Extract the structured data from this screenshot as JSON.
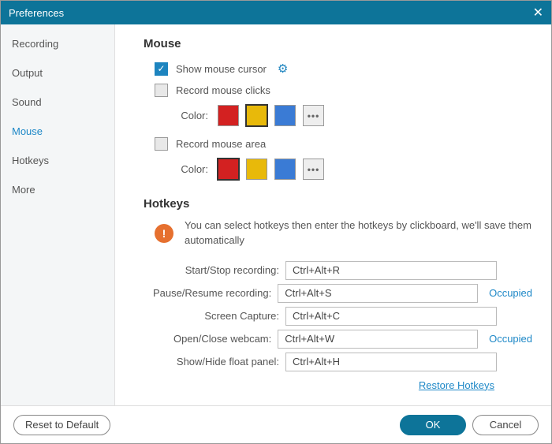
{
  "window": {
    "title": "Preferences"
  },
  "sidebar": {
    "items": [
      {
        "label": "Recording"
      },
      {
        "label": "Output"
      },
      {
        "label": "Sound"
      },
      {
        "label": "Mouse"
      },
      {
        "label": "Hotkeys"
      },
      {
        "label": "More"
      }
    ]
  },
  "mouse": {
    "heading": "Mouse",
    "show_cursor_label": "Show mouse cursor",
    "record_clicks_label": "Record mouse clicks",
    "record_area_label": "Record mouse area",
    "color_label": "Color:",
    "colors_clicks": {
      "red": "#d32121",
      "yellow": "#e8b90a",
      "blue": "#3a7bd5"
    },
    "colors_area": {
      "red": "#d32121",
      "yellow": "#e8b90a",
      "blue": "#3a7bd5"
    }
  },
  "hotkeys": {
    "heading": "Hotkeys",
    "info": "You can select hotkeys then enter the hotkeys by clickboard, we'll save them automatically",
    "rows": [
      {
        "label": "Start/Stop recording:",
        "value": "Ctrl+Alt+R",
        "status": ""
      },
      {
        "label": "Pause/Resume recording:",
        "value": "Ctrl+Alt+S",
        "status": "Occupied"
      },
      {
        "label": "Screen Capture:",
        "value": "Ctrl+Alt+C",
        "status": ""
      },
      {
        "label": "Open/Close webcam:",
        "value": "Ctrl+Alt+W",
        "status": "Occupied"
      },
      {
        "label": "Show/Hide float panel:",
        "value": "Ctrl+Alt+H",
        "status": ""
      }
    ],
    "restore_label": "Restore Hotkeys"
  },
  "footer": {
    "reset_label": "Reset to Default",
    "ok_label": "OK",
    "cancel_label": "Cancel"
  }
}
